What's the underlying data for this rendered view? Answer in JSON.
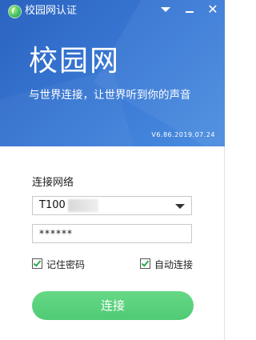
{
  "window": {
    "title": "校园网认证"
  },
  "banner": {
    "hero_text": "校园网",
    "slogan": "与世界连接，让世界听到你的声音",
    "version": "V6.86.2019.07.24",
    "colors": {
      "banner_blue": "#3a7ad6",
      "accent_green": "#4fcb74"
    }
  },
  "form": {
    "section_label": "连接网络",
    "network_select": {
      "value": "T100"
    },
    "password": {
      "value": "******"
    },
    "remember_password": {
      "label": "记住密码",
      "checked": true
    },
    "auto_connect": {
      "label": "自动连接",
      "checked": true
    },
    "connect_button": {
      "label": "连接"
    }
  },
  "icons": {
    "logo": "app-logo-icon",
    "dropdown": "chevron-down-icon",
    "minimize": "minimize-icon",
    "close": "close-icon"
  }
}
